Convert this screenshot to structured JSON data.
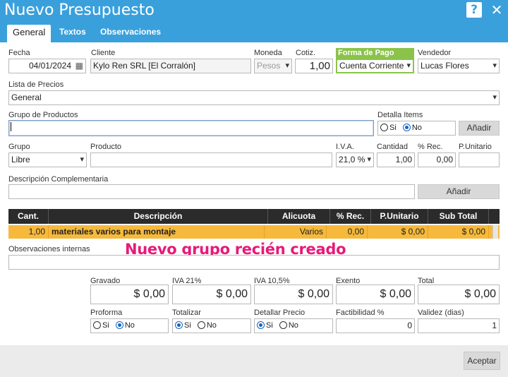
{
  "window": {
    "title": "Nuevo Presupuesto"
  },
  "tabs": [
    {
      "label": "General"
    },
    {
      "label": "Textos"
    },
    {
      "label": "Observaciones"
    }
  ],
  "header": {
    "fecha": {
      "label": "Fecha",
      "value": "04/01/2024"
    },
    "cliente": {
      "label": "Cliente",
      "value": "Kylo Ren SRL [El Corralón]"
    },
    "moneda": {
      "label": "Moneda",
      "value": "Pesos"
    },
    "cotiz": {
      "label": "Cotiz.",
      "value": "1,00"
    },
    "forma_pago": {
      "label": "Forma de Pago",
      "value": "Cuenta Corriente"
    },
    "vendedor": {
      "label": "Vendedor",
      "value": "Lucas Flores"
    }
  },
  "lista_precios": {
    "label": "Lista de Precios",
    "value": "General"
  },
  "grupo_productos": {
    "label": "Grupo de Productos",
    "value": ""
  },
  "detalla_items": {
    "label": "Detalla Items",
    "si": "Si",
    "no": "No",
    "selected": "no"
  },
  "anadir_label": "Añadir",
  "item_entry": {
    "grupo": {
      "label": "Grupo",
      "value": "Libre"
    },
    "producto": {
      "label": "Producto",
      "value": ""
    },
    "iva": {
      "label": "I.V.A.",
      "value": "21,0 %"
    },
    "cantidad": {
      "label": "Cantidad",
      "value": "1,00"
    },
    "rec": {
      "label": "% Rec.",
      "value": "0,00"
    },
    "punitario": {
      "label": "P.Unitario",
      "value": ""
    }
  },
  "descripcion_complementaria": {
    "label": "Descripción Complementaria",
    "value": ""
  },
  "grid": {
    "columns": [
      "Cant.",
      "Descripción",
      "Alicuota",
      "% Rec.",
      "P.Unitario",
      "Sub Total"
    ],
    "rows": [
      {
        "cant": "1,00",
        "descripcion": "materiales varios para montaje",
        "alicuota": "Varios",
        "rec": "0,00",
        "punitario": "$ 0,00",
        "subtotal": "$ 0,00"
      }
    ]
  },
  "overlay_text": "Nuevo grupo recién creado",
  "observaciones": {
    "label": "Observaciones internas",
    "value": ""
  },
  "totals": {
    "gravado": {
      "label": "Gravado",
      "value": "$ 0,00"
    },
    "iva21": {
      "label": "IVA 21%",
      "value": "$ 0,00"
    },
    "iva105": {
      "label": "IVA 10,5%",
      "value": "$ 0,00"
    },
    "exento": {
      "label": "Exento",
      "value": "$ 0,00"
    },
    "total": {
      "label": "Total",
      "value": "$ 0,00"
    }
  },
  "options": {
    "proforma": {
      "label": "Proforma",
      "si": "Si",
      "no": "No",
      "selected": "no"
    },
    "totalizar": {
      "label": "Totalizar",
      "si": "Si",
      "no": "No",
      "selected": "si"
    },
    "detallar_precio": {
      "label": "Detallar Precio",
      "si": "Si",
      "no": "No",
      "selected": "si"
    },
    "factibilidad": {
      "label": "Factibilidad %",
      "value": "0"
    },
    "validez": {
      "label": "Validez (dias)",
      "value": "1"
    }
  },
  "footer": {
    "aceptar_label": "Aceptar"
  },
  "colors": {
    "titlebar": "#3aa0dc",
    "highlight": "#f6b93b",
    "forma_pago_accent": "#8bc34a",
    "overlay": "#e8197a"
  },
  "icons": {
    "help": "help-icon",
    "close": "close-icon",
    "calendar": "calendar-icon",
    "dropdown": "chevron-down-icon"
  }
}
